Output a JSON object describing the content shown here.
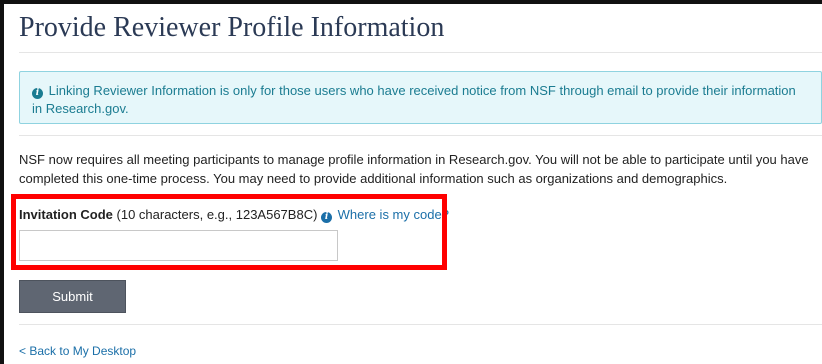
{
  "page": {
    "title": "Provide Reviewer Profile Information"
  },
  "alert": {
    "icon": "info-circle-icon",
    "text": "Linking Reviewer Information is only for those users who have received notice from NSF through email to provide their information in Research.gov."
  },
  "intro": {
    "text": "NSF now requires all meeting participants to manage profile information in Research.gov. You will not be able to participate until you have completed this one-time process. You may need to provide additional information such as organizations and demographics."
  },
  "invitation": {
    "label": "Invitation Code",
    "hint": "(10 characters, e.g., 123A567B8C)",
    "help_icon": "info-circle-icon",
    "help_link": "Where is my code?",
    "value": "",
    "placeholder": ""
  },
  "actions": {
    "submit_label": "Submit"
  },
  "nav": {
    "back_label": "< Back to My Desktop"
  },
  "colors": {
    "highlight": "#ff0000",
    "alert_bg": "#e6f7fa",
    "alert_text": "#1b7c91",
    "button_bg": "#5f6672",
    "link": "#1b6fa8"
  }
}
